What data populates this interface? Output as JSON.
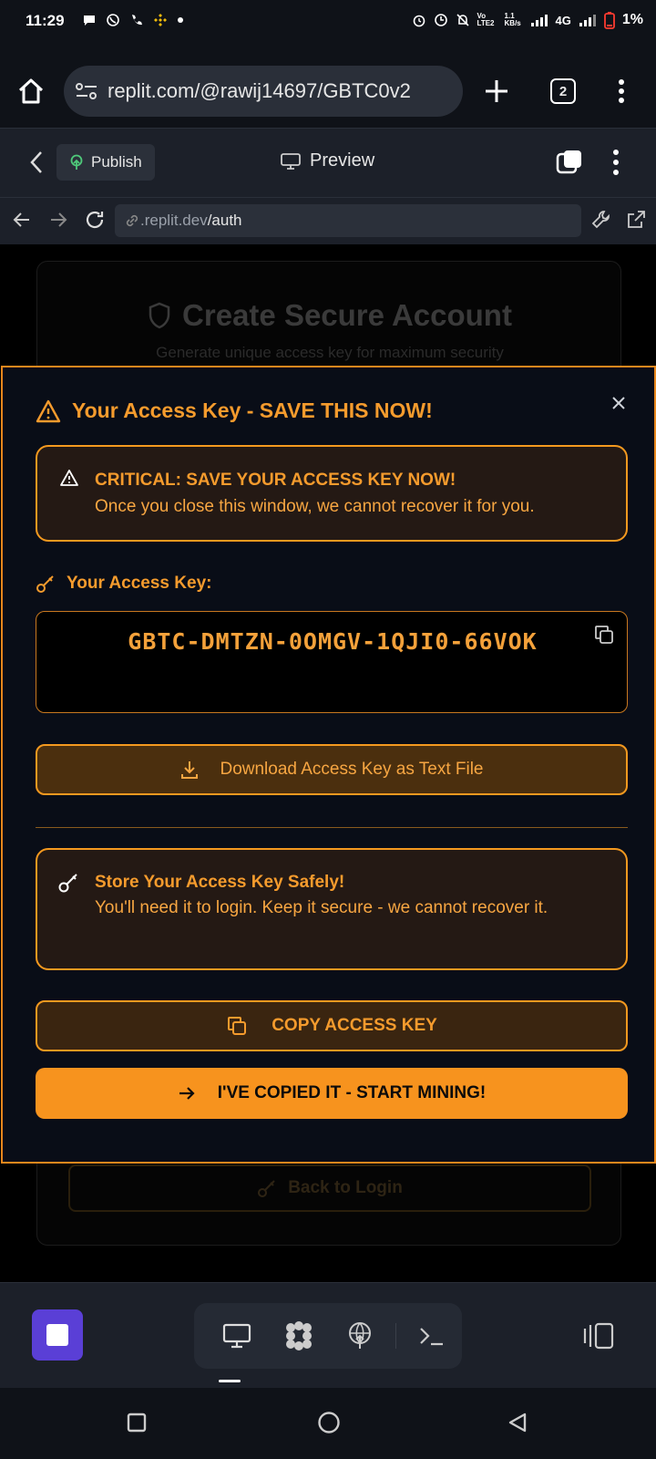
{
  "status_bar": {
    "time": "11:29",
    "network": "4G",
    "battery": "1%",
    "volte": "Vo LTE2",
    "speed": "1.1 KB/s"
  },
  "browser": {
    "url": "replit.com/@rawij14697/GBTC0v2",
    "tab_count": "2"
  },
  "replit_header": {
    "publish_label": "Publish",
    "preview_label": "Preview"
  },
  "preview_nav": {
    "url_domain": ".replit.dev",
    "url_path": "/auth"
  },
  "background_page": {
    "title": "Create Secure Account",
    "subtitle": "Generate unique access key for maximum security",
    "back_button": "Back to Login"
  },
  "modal": {
    "title": "Your Access Key - SAVE THIS NOW!",
    "warning_heading": "CRITICAL: SAVE YOUR ACCESS KEY NOW!",
    "warning_text": "Once you close this window, we cannot recover it for you.",
    "key_label": "Your Access Key:",
    "access_key": "GBTC-DMTZN-0OMGV-1QJI0-66VOK",
    "download_button": "Download Access Key as Text File",
    "store_heading": "Store Your Access Key Safely!",
    "store_text": "You'll need it to login. Keep it secure - we cannot recover it.",
    "copy_button": "COPY ACCESS KEY",
    "confirm_button": "I'VE COPIED IT - START MINING!"
  },
  "colors": {
    "accent_orange": "#f7931e",
    "modal_bg": "#090d17",
    "replit_purple": "#5a3fd6"
  }
}
